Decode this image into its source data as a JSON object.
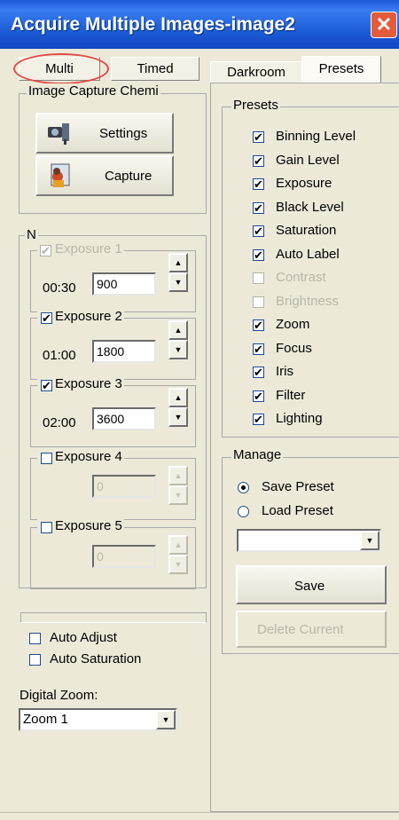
{
  "window": {
    "title": "Acquire Multiple Images-image2",
    "close_glyph": "✕"
  },
  "left_tabs": {
    "multi": "Multi",
    "timed": "Timed"
  },
  "right_tabs": {
    "darkroom": "Darkroom",
    "presets": "Presets"
  },
  "capture_group": {
    "legend": "Image Capture Chemi",
    "settings_label": "Settings",
    "capture_label": "Capture"
  },
  "exposures": {
    "group_label": "N",
    "items": [
      {
        "label": "Exposure 1",
        "time": "00:30",
        "value": "900",
        "checked": true,
        "enabled": false
      },
      {
        "label": "Exposure 2",
        "time": "01:00",
        "value": "1800",
        "checked": true,
        "enabled": true
      },
      {
        "label": "Exposure 3",
        "time": "02:00",
        "value": "3600",
        "checked": true,
        "enabled": true
      },
      {
        "label": "Exposure 4",
        "time": "",
        "value": "0",
        "checked": false,
        "enabled": false
      },
      {
        "label": "Exposure 5",
        "time": "",
        "value": "0",
        "checked": false,
        "enabled": false
      }
    ]
  },
  "auto_adjust": "Auto Adjust",
  "auto_saturation": "Auto Saturation",
  "digital_zoom": {
    "label": "Digital Zoom:",
    "value": "Zoom 1"
  },
  "presets": {
    "legend": "Presets",
    "items": [
      {
        "label": "Binning Level",
        "checked": true,
        "enabled": true
      },
      {
        "label": "Gain Level",
        "checked": true,
        "enabled": true
      },
      {
        "label": "Exposure",
        "checked": true,
        "enabled": true
      },
      {
        "label": "Black Level",
        "checked": true,
        "enabled": true
      },
      {
        "label": "Saturation",
        "checked": true,
        "enabled": true
      },
      {
        "label": "Auto Label",
        "checked": true,
        "enabled": true
      },
      {
        "label": "Contrast",
        "checked": false,
        "enabled": false
      },
      {
        "label": "Brightness",
        "checked": false,
        "enabled": false
      },
      {
        "label": "Zoom",
        "checked": true,
        "enabled": true
      },
      {
        "label": "Focus",
        "checked": true,
        "enabled": true
      },
      {
        "label": "Iris",
        "checked": true,
        "enabled": true
      },
      {
        "label": "Filter",
        "checked": true,
        "enabled": true
      },
      {
        "label": "Lighting",
        "checked": true,
        "enabled": true
      }
    ]
  },
  "manage": {
    "legend": "Manage",
    "save_preset": "Save Preset",
    "load_preset": "Load Preset",
    "preset_select_value": "",
    "save_button": "Save",
    "delete_button": "Delete Current"
  },
  "glyphs": {
    "check": "✔",
    "up": "▲",
    "down": "▼"
  },
  "colors": {
    "titlebar": "#1e5fd8",
    "highlight_circle": "#e14b46",
    "face": "#ece9d8"
  }
}
